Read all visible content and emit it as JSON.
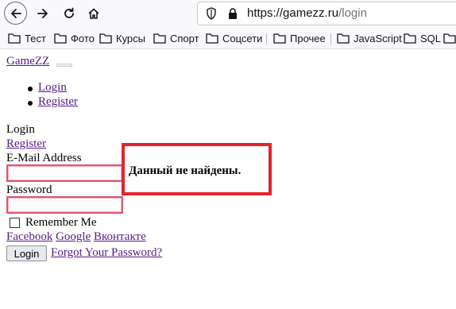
{
  "browser": {
    "url_host": "https://gamezz.ru",
    "url_path": "/login",
    "bookmarks": [
      "Тест",
      "Фото",
      "Курсы",
      "Спорт",
      "Соцсети",
      "Прочее",
      "JavaScript",
      "SQL"
    ]
  },
  "navbar": {
    "brand": "GameZZ",
    "links": [
      "Login",
      "Register"
    ]
  },
  "form": {
    "title": "Login",
    "register_link": "Register",
    "email_label": "E-Mail Address",
    "email_value": "",
    "password_label": "Password",
    "password_value": "",
    "remember_label": "Remember Me",
    "remember_checked": false,
    "social_links": [
      "Facebook",
      "Google",
      "Вконтакте"
    ],
    "login_button": "Login",
    "forgot_link": "Forgot Your Password?"
  },
  "alert": {
    "message": "Данный не найдены.",
    "border_color": "#e4242c"
  }
}
